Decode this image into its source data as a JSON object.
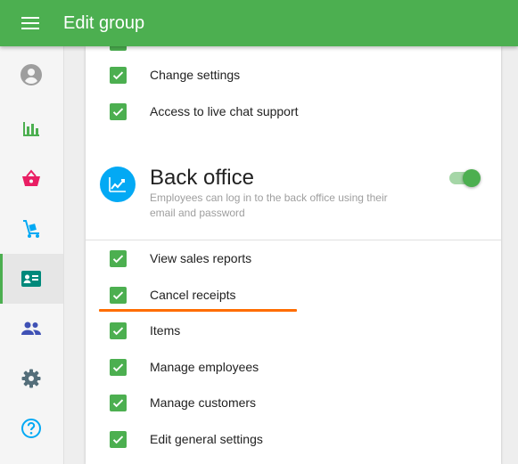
{
  "appbar": {
    "title": "Edit group",
    "menu_icon": "menu-icon"
  },
  "sidebar": {
    "items": [
      {
        "icon": "account-circle-icon",
        "color": "#9e9e9e",
        "active": false
      },
      {
        "icon": "bar-chart-icon",
        "color": "#4caf50",
        "active": false
      },
      {
        "icon": "shopping-basket-icon",
        "color": "#e91e63",
        "active": false
      },
      {
        "icon": "dolly-icon",
        "color": "#03a9f4",
        "active": false
      },
      {
        "icon": "badge-icon",
        "color": "#00897b",
        "active": true
      },
      {
        "icon": "group-icon",
        "color": "#3f51b5",
        "active": false
      },
      {
        "icon": "gear-icon",
        "color": "#546e7a",
        "active": false
      },
      {
        "icon": "help-circle-icon",
        "color": "#03a9f4",
        "active": false
      }
    ]
  },
  "pos_permissions": [
    {
      "label": "Change settings",
      "checked": true
    },
    {
      "label": "Access to live chat support",
      "checked": true
    }
  ],
  "back_office": {
    "title": "Back office",
    "description": "Employees can log in to the back office using their email and password",
    "enabled": true,
    "icon": "chart-trend-icon",
    "permissions": [
      {
        "label": "View sales reports",
        "checked": true
      },
      {
        "label": "Cancel receipts",
        "checked": true
      },
      {
        "label": "Items",
        "checked": true
      },
      {
        "label": "Manage employees",
        "checked": true
      },
      {
        "label": "Manage customers",
        "checked": true
      },
      {
        "label": "Edit general settings",
        "checked": true
      }
    ]
  },
  "colors": {
    "brand_green": "#4caf50",
    "accent_orange": "#ff6d00",
    "icon_blue": "#03a9f4"
  }
}
